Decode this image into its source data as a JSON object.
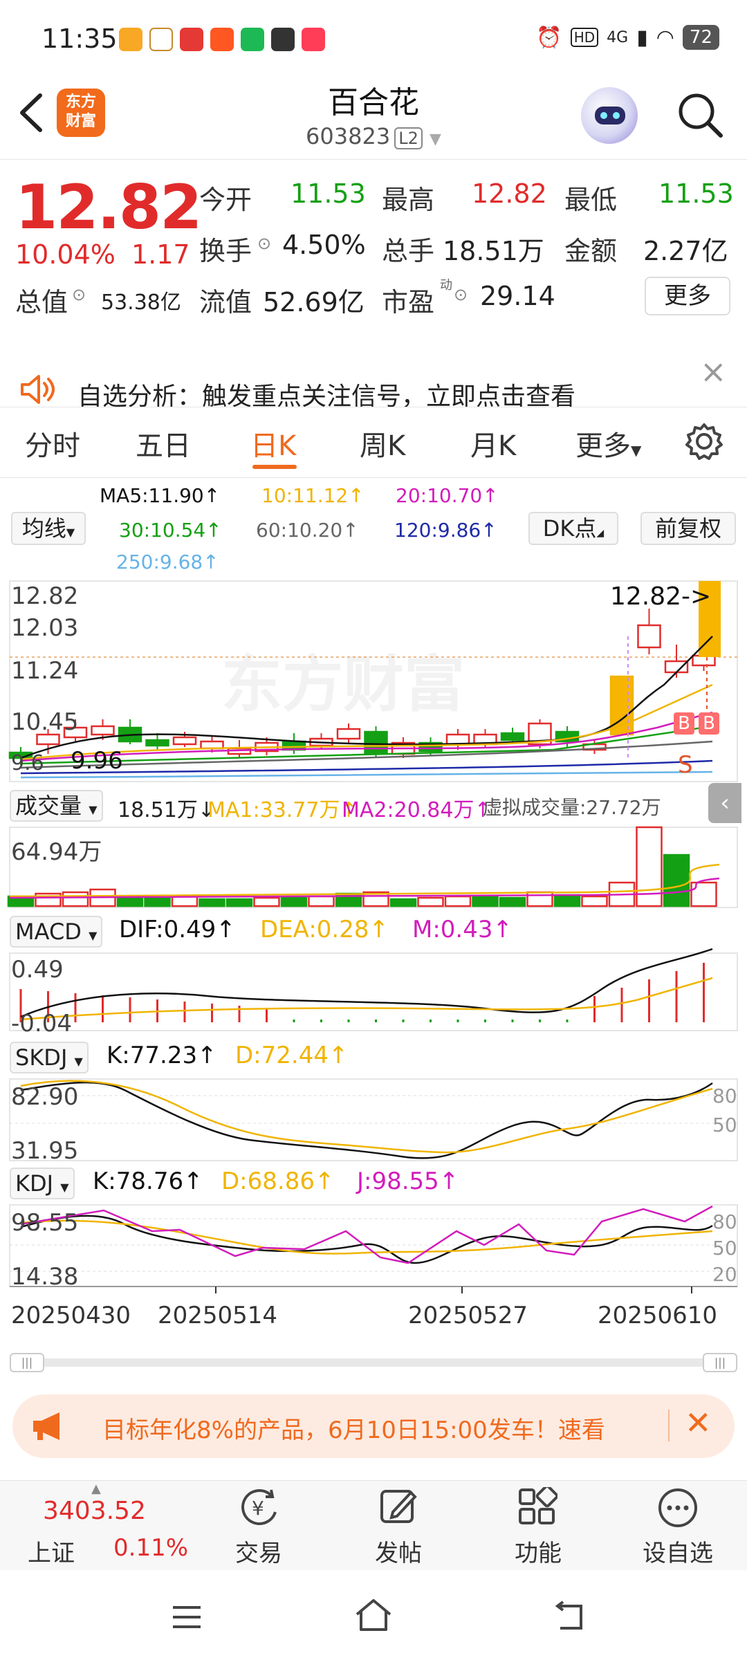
{
  "status_bar": {
    "time": "11:35",
    "network": "4G",
    "battery": "72"
  },
  "header": {
    "back_icon": "chevron-left-icon",
    "logo_line1": "东方",
    "logo_line2": "财富",
    "title": "百合花",
    "code": "603823",
    "level": "L2"
  },
  "quote": {
    "price": "12.82",
    "pct": "10.04%",
    "change": "1.17",
    "open_label": "今开",
    "open": "11.53",
    "high_label": "最高",
    "high": "12.82",
    "low_label": "最低",
    "low": "11.53",
    "turnover_label": "换手",
    "turnover": "4.50%",
    "volume_label": "总手",
    "volume": "18.51万",
    "amount_label": "金额",
    "amount": "2.27亿",
    "mktcap_label": "总值",
    "mktcap": "53.38亿",
    "float_label": "流值",
    "float": "52.69亿",
    "pe_label": "市盈",
    "pe_sup": "动",
    "pe": "29.14",
    "more": "更多"
  },
  "notice": {
    "text": "自选分析：触发重点关注信号，立即点击查看"
  },
  "tabs": [
    "分时",
    "五日",
    "日K",
    "周K",
    "月K",
    "更多"
  ],
  "active_tab": 2,
  "ma_legend": {
    "selector": "均线",
    "ma5": "MA5:11.90↑",
    "ma10": "10:11.12↑",
    "ma20": "20:10.70↑",
    "ma30": "30:10.54↑",
    "ma60": "60:10.20↑",
    "ma120": "120:9.86↑",
    "ma250": "250:9.68↑",
    "dk_button": "DK点",
    "fq_button": "前复权"
  },
  "kline": {
    "axis_labels": [
      "12.82",
      "12.03",
      "11.24",
      "10.45"
    ],
    "price_marker": "12.82->",
    "low_marker": "9.96",
    "bottom_axis_label": "9.6",
    "watermark": "东方财富",
    "signals": [
      "B",
      "B",
      "S"
    ]
  },
  "volume": {
    "selector": "成交量",
    "value": "18.51万↓",
    "ma1": "MA1:33.77万↑",
    "ma2": "MA2:20.84万↑",
    "virtual": "虚拟成交量:27.72万",
    "axis_max": "64.94万"
  },
  "macd": {
    "selector": "MACD",
    "dif": "DIF:0.49↑",
    "dea": "DEA:0.28↑",
    "m": "M:0.43↑",
    "axis_top": "0.49",
    "axis_bottom": "-0.04"
  },
  "skdj": {
    "selector": "SKDJ",
    "k": "K:77.23↑",
    "d": "D:72.44↑",
    "axis_top": "82.90",
    "axis_bottom": "31.95",
    "right_80": "80",
    "right_50": "50"
  },
  "kdj": {
    "selector": "KDJ",
    "k": "K:78.76↑",
    "d": "D:68.86↑",
    "j": "J:98.55↑",
    "axis_top": "98.55",
    "axis_bottom": "14.38",
    "right_80": "80",
    "right_50": "50",
    "right_20": "20"
  },
  "dates": [
    "20250430",
    "20250514",
    "20250527",
    "20250610"
  ],
  "banner": {
    "text": "目标年化8%的产品，6月10日15:00发车！速看"
  },
  "bottom_nav": {
    "index_value": "3403.52",
    "index_name": "上证",
    "index_pct": "0.11%",
    "items": [
      "交易",
      "发帖",
      "功能",
      "设自选"
    ]
  },
  "colors": {
    "up": "#e12b2b",
    "down": "#14a014",
    "accent": "#f06a1e",
    "ma5": "#111111",
    "ma10": "#f0b400",
    "ma20": "#d21cbc",
    "ma30": "#14a014",
    "ma60": "#666666",
    "ma120": "#1e2aa8",
    "ma250": "#66b3e8"
  }
}
